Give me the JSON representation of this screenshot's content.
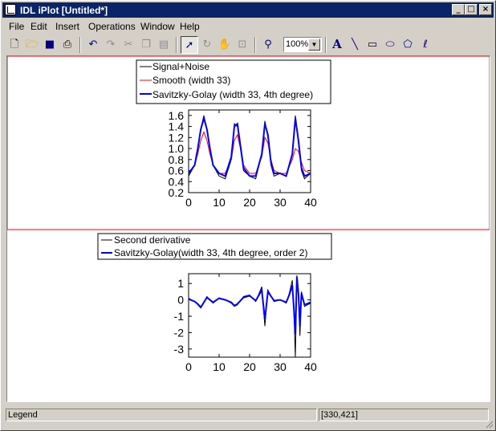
{
  "window": {
    "title": "IDL iPlot [Untitled*]"
  },
  "title_buttons": [
    "minimize-icon",
    "maximize-icon",
    "close-icon"
  ],
  "menu": [
    "File",
    "Edit",
    "Insert",
    "Operations",
    "Window",
    "Help"
  ],
  "toolbar": {
    "tools": [
      "new-file-icon",
      "open-folder-icon",
      "save-icon",
      "print-icon",
      "undo-icon",
      "redo-icon",
      "cut-icon",
      "copy-icon",
      "paste-icon",
      "select-arrow-icon",
      "rotate-icon",
      "pan-hand-icon",
      "data-range-icon",
      "zoom-magnifier-icon",
      "text-tool-icon",
      "line-tool-icon",
      "rectangle-tool-icon",
      "oval-tool-icon",
      "polygon-tool-icon",
      "freehand-tool-icon"
    ],
    "zoom_value": "100%"
  },
  "plot1": {
    "legend": [
      {
        "label": "Signal+Noise",
        "color": "#000000"
      },
      {
        "label": "Smooth (width 33)",
        "color": "#ff0000"
      },
      {
        "label": "Savitzky-Golay (width 33, 4th degree)",
        "color": "#0000ff"
      }
    ]
  },
  "plot2": {
    "legend": [
      {
        "label": "Second derivative",
        "color": "#000000"
      },
      {
        "label": "Savitzky-Golay(width 33, 4th degree, order 2)",
        "color": "#0000ff"
      }
    ]
  },
  "status": {
    "left": "Legend",
    "right": "[330,421]"
  },
  "chart_data": [
    {
      "type": "line",
      "x": [
        0,
        2,
        3,
        4,
        5,
        6,
        7,
        8,
        10,
        12,
        14,
        15,
        16,
        17,
        18,
        20,
        22,
        24,
        25,
        26,
        27,
        28,
        30,
        32,
        34,
        35,
        36,
        37,
        38,
        40
      ],
      "series": [
        {
          "name": "Signal+Noise",
          "color": "#000000",
          "values": [
            0.5,
            0.7,
            1.0,
            1.35,
            1.6,
            1.35,
            1.0,
            0.7,
            0.5,
            0.45,
            0.8,
            1.45,
            1.4,
            1.0,
            0.6,
            0.5,
            0.45,
            0.9,
            1.5,
            1.2,
            0.7,
            0.5,
            0.55,
            0.5,
            0.9,
            1.6,
            1.1,
            0.6,
            0.45,
            0.55
          ]
        },
        {
          "name": "Smooth (width 33)",
          "color": "#ff0000",
          "values": [
            0.55,
            0.7,
            0.9,
            1.15,
            1.3,
            1.15,
            0.9,
            0.7,
            0.55,
            0.55,
            0.8,
            1.15,
            1.25,
            1.0,
            0.7,
            0.55,
            0.55,
            0.85,
            1.2,
            1.1,
            0.8,
            0.6,
            0.55,
            0.55,
            0.8,
            1.0,
            0.95,
            0.75,
            0.6,
            0.55
          ]
        },
        {
          "name": "Savitzky-Golay (width 33, 4th degree)",
          "color": "#0000ff",
          "values": [
            0.55,
            0.7,
            1.0,
            1.35,
            1.55,
            1.35,
            1.0,
            0.7,
            0.55,
            0.5,
            0.85,
            1.4,
            1.45,
            1.05,
            0.65,
            0.5,
            0.5,
            0.9,
            1.45,
            1.25,
            0.75,
            0.55,
            0.55,
            0.5,
            0.9,
            1.55,
            1.15,
            0.65,
            0.5,
            0.55
          ]
        }
      ],
      "xlim": [
        0,
        40
      ],
      "ylim": [
        0.2,
        1.7
      ],
      "xticks": [
        0,
        10,
        20,
        30,
        40
      ],
      "yticks": [
        0.2,
        0.4,
        0.6,
        0.8,
        1.0,
        1.2,
        1.4,
        1.6
      ],
      "ytick_labels": [
        "0.2",
        "0.4",
        "0.6",
        "0.8",
        "1.0",
        "1.2",
        "1.4",
        "1.6"
      ],
      "legend_position": "top"
    },
    {
      "type": "line",
      "x": [
        0,
        2,
        3,
        4,
        6,
        8,
        10,
        12,
        14,
        15,
        16,
        18,
        20,
        22,
        24,
        25,
        26,
        28,
        30,
        32,
        33,
        34,
        34.5,
        35,
        35.5,
        36,
        36.5,
        37,
        38,
        40
      ],
      "series": [
        {
          "name": "Second derivative",
          "color": "#000000",
          "values": [
            0.1,
            -0.1,
            -0.3,
            -0.5,
            0.2,
            -0.2,
            0.1,
            0.0,
            -0.2,
            -0.4,
            -0.3,
            0.2,
            0.3,
            -0.1,
            0.8,
            -1.6,
            0.6,
            -0.1,
            0.0,
            -0.2,
            0.4,
            1.2,
            -0.6,
            -3.5,
            1.5,
            0.6,
            -2.2,
            0.5,
            -0.4,
            -0.2
          ]
        },
        {
          "name": "Savitzky-Golay(width 33, 4th degree, order 2)",
          "color": "#0000ff",
          "values": [
            0.05,
            -0.1,
            -0.25,
            -0.45,
            0.15,
            -0.15,
            0.1,
            0.0,
            -0.15,
            -0.35,
            -0.25,
            0.15,
            0.25,
            -0.05,
            0.6,
            -1.2,
            0.5,
            -0.05,
            0.0,
            -0.15,
            0.3,
            0.9,
            -0.5,
            -2.1,
            1.4,
            0.4,
            -1.6,
            0.4,
            -0.3,
            -0.15
          ]
        }
      ],
      "xlim": [
        0,
        40
      ],
      "ylim": [
        -3.5,
        1.6
      ],
      "xticks": [
        0,
        10,
        20,
        30,
        40
      ],
      "yticks": [
        -3,
        -2,
        -1,
        0,
        1
      ],
      "legend_position": "top"
    }
  ]
}
